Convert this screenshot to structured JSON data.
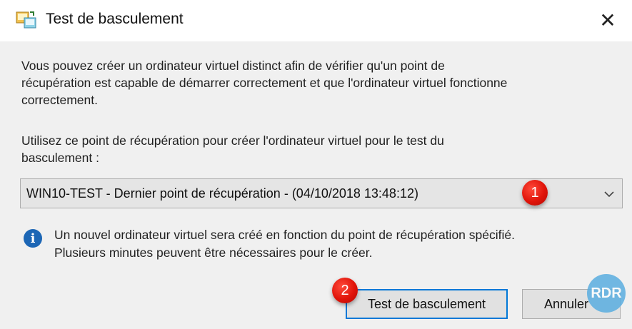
{
  "window": {
    "title": "Test de basculement",
    "close_glyph": "✕"
  },
  "description": "Vous pouvez créer un ordinateur virtuel distinct afin de vérifier qu'un point de\nrécupération est capable de démarrer correctement et que l'ordinateur virtuel fonctionne\ncorrectement.",
  "select_prompt": "Utilisez ce point de récupération pour créer l'ordinateur virtuel pour le test du\nbasculement :",
  "recovery_point": {
    "selected": "WIN10-TEST - Dernier point de récupération - (04/10/2018 13:48:12)"
  },
  "info": {
    "icon": "info-icon",
    "text": "Un nouvel ordinateur virtuel sera créé en fonction du point de récupération spécifié.\nPlusieurs minutes peuvent être nécessaires pour le créer."
  },
  "buttons": {
    "primary": "Test de basculement",
    "cancel": "Annuler"
  },
  "annotations": {
    "badge1": "1",
    "badge2": "2"
  },
  "watermark": "RDR",
  "colors": {
    "accent": "#0078d7",
    "badge": "#e0140a",
    "info": "#1c66b5"
  }
}
